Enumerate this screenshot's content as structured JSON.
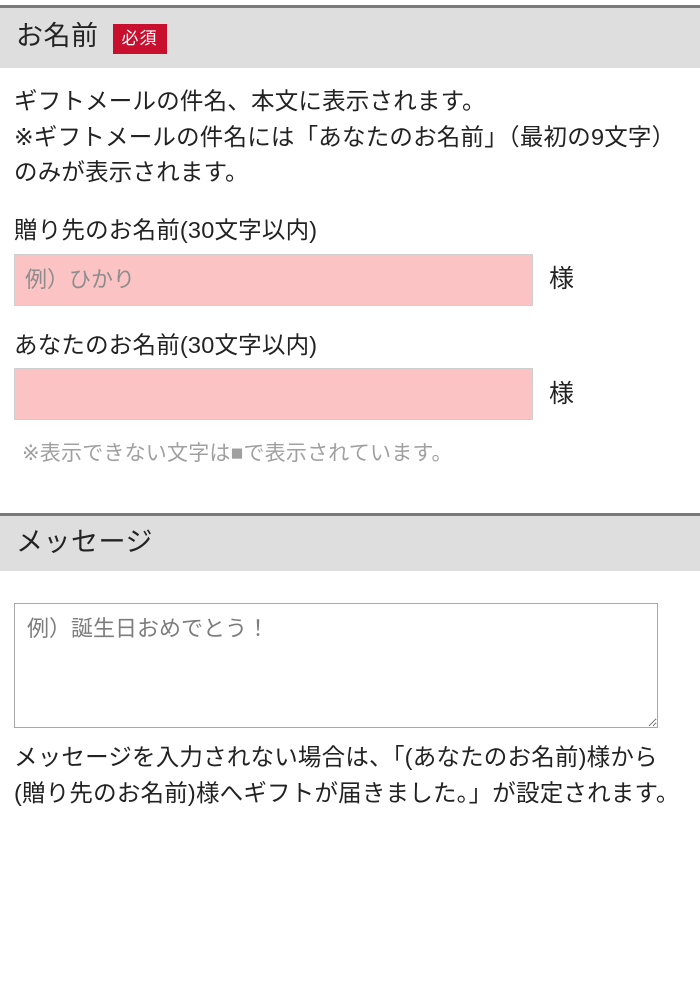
{
  "sections": [
    {
      "id": "name",
      "title": "お名前",
      "badge": "必須",
      "badge_color": "#c8102e",
      "intro_lines": [
        "ギフトメールの件名、本文に表示されます。",
        "※ギフトメールの件名には「あなたのお名前」（最初の9文字）のみが表示されます。"
      ],
      "fields": [
        {
          "label": "贈り先のお名前(30文字以内)",
          "placeholder": "例）ひかり",
          "value": "",
          "suffix": "様",
          "background": "#fbc3c3"
        },
        {
          "label": "あなたのお名前(30文字以内)",
          "placeholder": "",
          "value": "",
          "suffix": "様",
          "background": "#fbc3c3"
        }
      ],
      "note": "※表示できない文字は■で表示されています。"
    },
    {
      "id": "message",
      "title": "メッセージ",
      "badge": "",
      "textarea": {
        "placeholder": "例）誕生日おめでとう！",
        "value": ""
      },
      "outro": "メッセージを入力されない場合は、「(あなたのお名前)様から(贈り先のお名前)様へギフトが届きました。」が設定されます。"
    }
  ]
}
